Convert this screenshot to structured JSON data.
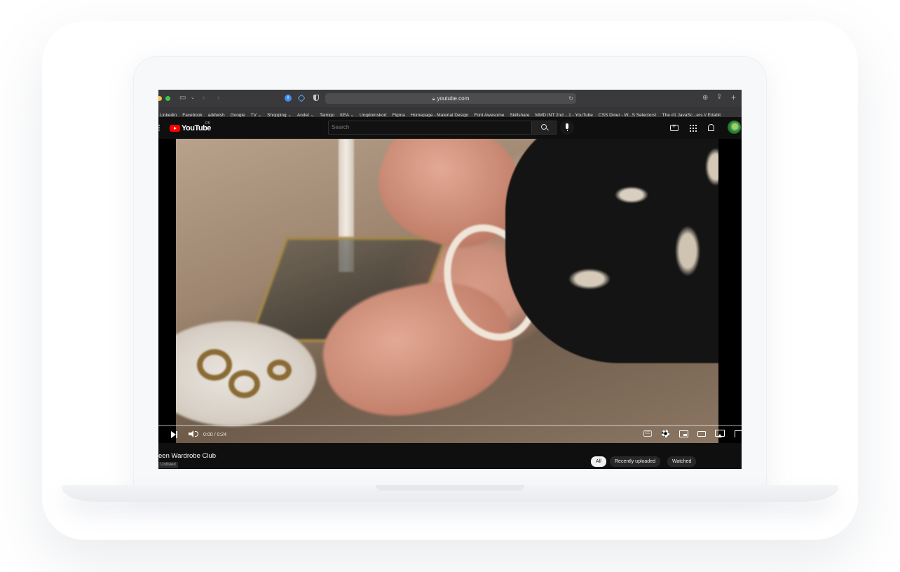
{
  "browser": {
    "url": "youtube.com",
    "bookmarks": [
      "Linkedin",
      "Facebook",
      "addwish",
      "Google",
      "TV ⌄",
      "Shopping ⌄",
      "Andet ⌄",
      "Tamigo",
      "KEA ⌄",
      "Ungdomskort",
      "Figma",
      "Homepage - Material Design",
      "Font Awesome",
      "Skillshare",
      "MMD INT 2nd ...1 - YouTube",
      "CSS Diner - W...S Selectors!",
      "The #1 JavaSc...ers // Edabit"
    ]
  },
  "youtube": {
    "logo_text": "YouTube",
    "country_code": "DK",
    "search_placeholder": "Search"
  },
  "player": {
    "time": "0:00 / 0:24",
    "progress_fraction": 0.0,
    "cc_label": "CC"
  },
  "video": {
    "title": "een Wardrobe Club",
    "visibility_badge": "Unlisted"
  },
  "chips": [
    "All",
    "Recently uploaded",
    "Watched"
  ],
  "colors": {
    "youtube_red": "#ff0000",
    "page_bg": "#0f0f0f",
    "chip_active_bg": "#f1f1f1"
  }
}
